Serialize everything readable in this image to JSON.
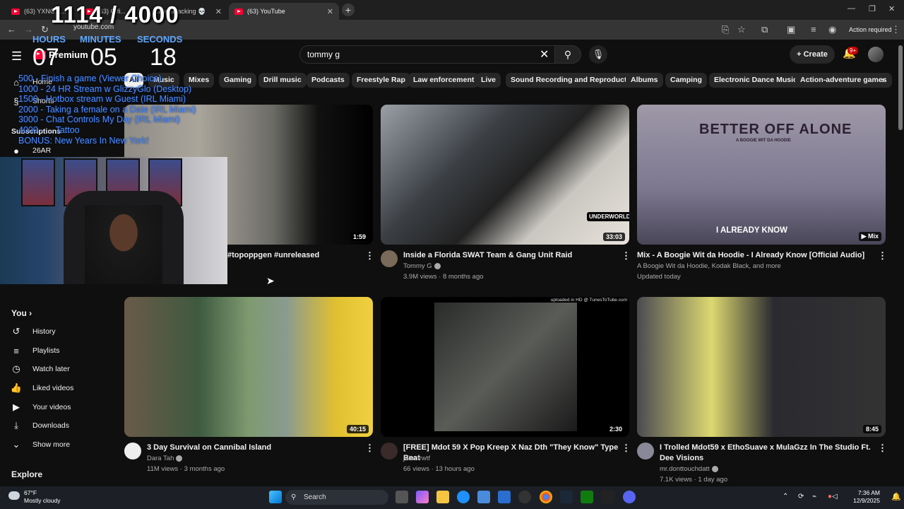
{
  "browser": {
    "tabs": [
      {
        "label": "(63) YXNG K..."
      },
      {
        "label": "(63) Offi..."
      },
      {
        "label": "caught lacking 💀"
      },
      {
        "label": "(63) YouTube"
      }
    ],
    "url": "youtube.com",
    "action_required": "Action required"
  },
  "overlay": {
    "counter": "1114 / 4000",
    "hours_label": "HOURS",
    "minutes_label": "MINUTES",
    "seconds_label": "SECONDS",
    "hours": "07",
    "minutes": "05",
    "seconds": "18",
    "goals": [
      "500 - Finish a game (Viewer Choice)",
      "1000 - 24 HR Stream w GlizzyGlo (Desktop)",
      "1500 - Hotbox stream w Guest (IRL Miami)",
      "2000 - Taking a female on a Date (IRL Miami)",
      "3000 - Chat Controls My Day (IRL Miami)",
      "4000 - ... Tattoo",
      "BONUS: New Years In New York!"
    ]
  },
  "header": {
    "logo": "Premium",
    "search_value": "tommy g",
    "create": "Create",
    "notif_count": "9+"
  },
  "chips": [
    {
      "label": "All",
      "selected": true
    },
    {
      "label": "Music"
    },
    {
      "label": "Mixes"
    },
    {
      "label": "Gaming"
    },
    {
      "label": "Drill music"
    },
    {
      "label": "Podcasts"
    },
    {
      "label": "Freestyle Rap"
    },
    {
      "label": "Law enforcement"
    },
    {
      "label": "Live"
    },
    {
      "label": "Sound Recording and Reproduction"
    },
    {
      "label": "Albums"
    },
    {
      "label": "Camping"
    },
    {
      "label": "Electronic Dance Music"
    },
    {
      "label": "Action-adventure games"
    }
  ],
  "sidebar": {
    "home": "Home",
    "shorts": "Shorts",
    "subscriptions": "Subscriptions",
    "sub1": "26AR",
    "you": "You",
    "items": [
      "History",
      "Playlists",
      "Watch later",
      "Liked videos",
      "Your videos",
      "Downloads",
      "Show more"
    ],
    "explore": "Explore"
  },
  "videos": [
    {
      "title": "#topoppgen #unreleased",
      "channel": "",
      "meta": "",
      "duration": "1:59"
    },
    {
      "title": "Inside a Florida SWAT Team & Gang Unit Raid",
      "channel": "Tommy G",
      "meta": "3.9M views · 8 months ago",
      "duration": "33:03"
    },
    {
      "title": "Mix - A Boogie Wit da Hoodie - I Already Know [Official Audio]",
      "channel": "A Boogie Wit da Hoodie, Kodak Black, and more",
      "meta": "Updated today",
      "duration": "Mix",
      "thumb_title": "BETTER OFF ALONE",
      "thumb_sub": "A BOOGIE WIT DA HOODIE",
      "thumb_caption": "I ALREADY KNOW"
    },
    {
      "title": "3 Day Survival on Cannibal Island",
      "channel": "Dara Tah",
      "meta": "11M views · 3 months ago",
      "duration": "40:15"
    },
    {
      "title": "[FREE] Mdot 59 X Pop Kreep X Naz Dth \"They Know\" Type Beat",
      "channel": "jahmirwtf",
      "meta": "66 views · 13 hours ago",
      "duration": "2:30",
      "watermark": "uploaded in HD @ TunesToTube.com"
    },
    {
      "title": "I Trolled Mdot59 x EthoSuave x MulaGzz In The Studio Ft. Dee Visions",
      "channel": "mr.donttouchdatt",
      "meta": "7.1K views · 1 day ago",
      "duration": "8:45"
    }
  ],
  "swat_badge": "UNDERWORLD",
  "taskbar": {
    "temp": "67°F",
    "weather": "Mostly cloudy",
    "search": "Search",
    "time": "7:36 AM",
    "date": "12/9/2025"
  },
  "colors": {
    "accent": "#ff0033",
    "goal_text": "#4d8dff",
    "timer_label": "#5fa8ff"
  }
}
